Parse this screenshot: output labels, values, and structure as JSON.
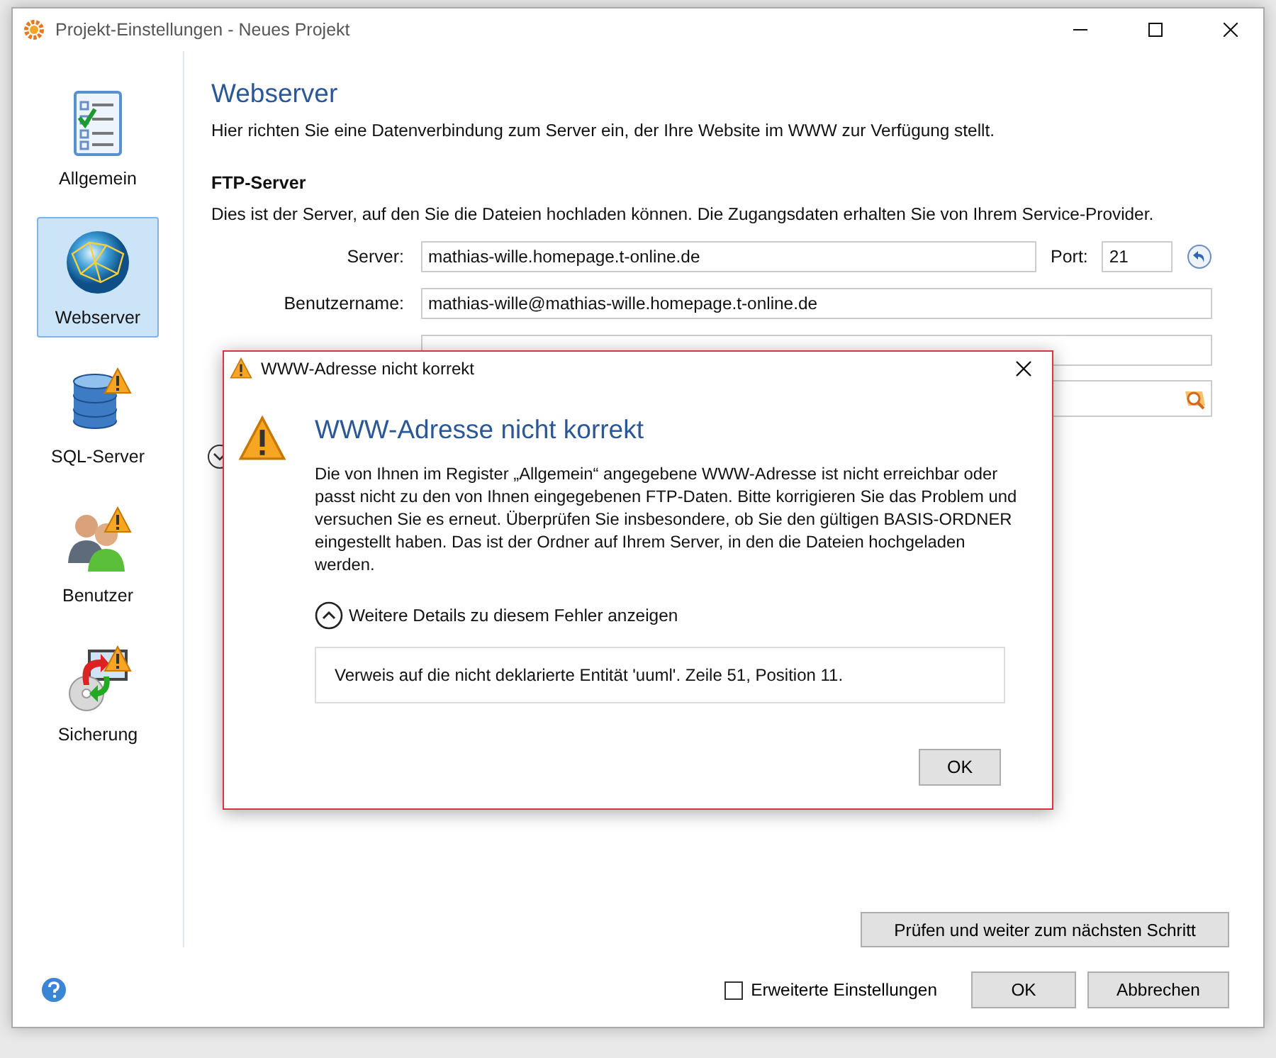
{
  "window": {
    "title": "Projekt-Einstellungen - Neues Projekt"
  },
  "sidebar": {
    "items": [
      {
        "label": "Allgemein",
        "kind": "checklist",
        "selected": false,
        "warning": false
      },
      {
        "label": "Webserver",
        "kind": "globe",
        "selected": true,
        "warning": false
      },
      {
        "label": "SQL-Server",
        "kind": "database",
        "selected": false,
        "warning": true
      },
      {
        "label": "Benutzer",
        "kind": "users",
        "selected": false,
        "warning": true
      },
      {
        "label": "Sicherung",
        "kind": "backup",
        "selected": false,
        "warning": true
      }
    ]
  },
  "page": {
    "title": "Webserver",
    "description": "Hier richten Sie eine Datenverbindung zum Server ein, der Ihre Website im WWW zur Verfügung stellt."
  },
  "ftp_section": {
    "title": "FTP-Server",
    "description": "Dies ist der Server, auf den Sie die Dateien hochladen können. Die Zugangsdaten erhalten Sie von Ihrem Service-Provider.",
    "server": {
      "label": "Server:",
      "value": "mathias-wille.homepage.t-online.de"
    },
    "port": {
      "label": "Port:",
      "value": "21"
    },
    "username": {
      "label": "Benutzername:",
      "value": "mathias-wille@mathias-wille.homepage.t-online.de"
    }
  },
  "next_button": "Prüfen und weiter zum nächsten Schritt",
  "advanced_settings": {
    "label": "Erweiterte Einstellungen",
    "checked": false
  },
  "buttons": [
    "OK",
    "Abbrechen"
  ],
  "dialog": {
    "title": "WWW-Adresse nicht korrekt",
    "heading": "WWW-Adresse nicht korrekt",
    "message": "Die von Ihnen im Register „Allgemein“ angegebene WWW-Adresse ist nicht erreichbar oder passt nicht zu den von Ihnen eingegebenen FTP-Daten. Bitte korrigieren Sie das Problem und versuchen Sie es erneut. Überprüfen Sie insbesondere, ob Sie den gültigen BASIS-ORDNER eingestellt haben. Das ist der Ordner auf Ihrem Server, in den die Dateien hochgeladen werden.",
    "details_toggle": {
      "label": "Weitere Details zu diesem Fehler anzeigen",
      "expanded": true
    },
    "details": "Verweis auf die nicht deklarierte Entität 'uuml'. Zeile 51, Position 11.",
    "button": "OK"
  }
}
